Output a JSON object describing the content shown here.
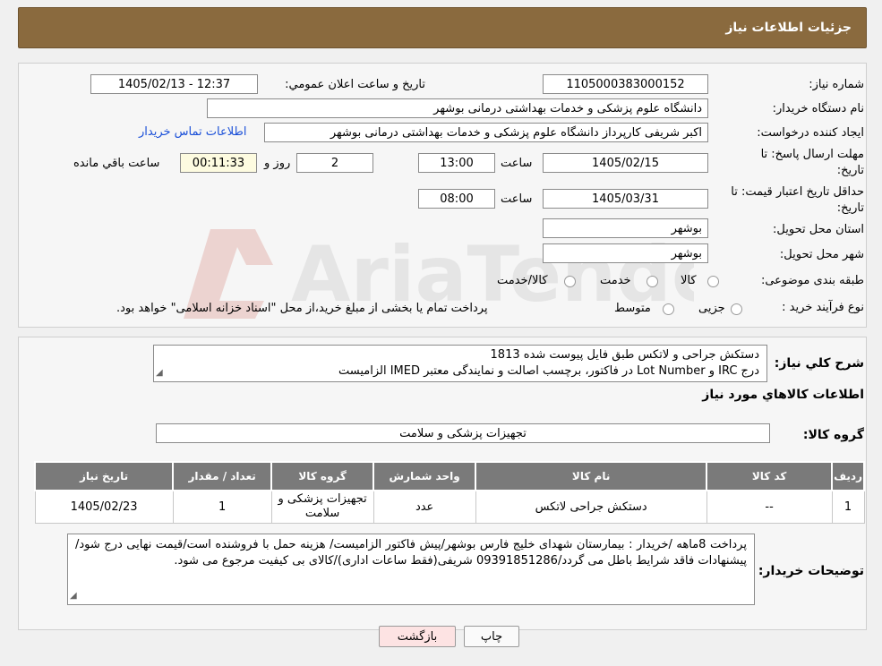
{
  "header": {
    "title": "جزئیات اطلاعات نیاز"
  },
  "form": {
    "need_number_label": "شماره نیاز:",
    "need_number": "1105000383000152",
    "announce_label": "تاریخ و ساعت اعلان عمومي:",
    "announce_value": "1405/02/13 - 12:37",
    "buyer_org_label": "نام دستگاه خریدار:",
    "buyer_org": "دانشگاه علوم پزشکی و خدمات بهداشتی درمانی بوشهر",
    "requester_label": "ایجاد کننده درخواست:",
    "requester": "اکبر شریفی کارپرداز دانشگاه علوم پزشکی و خدمات بهداشتی درمانی بوشهر",
    "contact_link": "اطلاعات تماس خریدار",
    "deadline_label": "مهلت ارسال پاسخ: تا تاریخ:",
    "deadline_date": "1405/02/15",
    "time_label": "ساعت",
    "deadline_time": "13:00",
    "days_value": "2",
    "days_label": "روز و",
    "remaining_time": "00:11:33",
    "remaining_label": "ساعت باقي مانده",
    "validity_label": "حداقل تاریخ اعتبار قیمت: تا تاریخ:",
    "validity_date": "1405/03/31",
    "validity_time": "08:00",
    "province_label": "استان محل تحویل:",
    "province": "بوشهر",
    "city_label": "شهر محل تحویل:",
    "city": "بوشهر",
    "category_label": "طبقه بندی موضوعی:",
    "category_options": [
      "کالا",
      "خدمت",
      "کالا/خدمت"
    ],
    "process_label": "نوع فرآیند خرید :",
    "process_options": [
      "جزیی",
      "متوسط"
    ],
    "process_note": "پرداخت تمام یا بخشی از مبلغ خرید،از محل \"اسناد خزانه اسلامی\" خواهد بود."
  },
  "description": {
    "label": "شرح کلي نیاز:",
    "line1": "دستکش جراحی و لاتکس طبق فایل پیوست شده 1813",
    "line2": "درج IRC و Lot Number در فاکتور، برچسب اصالت و نمایندگی معتبر IMED الزامیست"
  },
  "goods": {
    "section_title": "اطلاعات کالاهاي مورد نیاز",
    "group_label": "گروه کالا:",
    "group_value": "تجهیزات پزشکی و سلامت",
    "columns": [
      "ردیف",
      "کد کالا",
      "نام کالا",
      "واحد شمارش",
      "گروه کالا",
      "تعداد / مقدار",
      "تاریخ نیاز"
    ],
    "rows": [
      {
        "row": "1",
        "code": "--",
        "name": "دستکش جراحی لاتکس",
        "unit": "عدد",
        "group": "تجهیزات پزشکی و سلامت",
        "qty": "1",
        "date": "1405/02/23"
      }
    ]
  },
  "buyer_notes": {
    "label": "توضیحات خریدار:",
    "text": "پرداخت 8ماهه /خریدار : بیمارستان شهدای خلیج فارس بوشهر/پیش فاکتور الزامیست/ هزینه حمل با فروشنده است/قیمت نهایی درج شود/پیشنهادات فاقد شرایط باطل می گردد/09391851286 شریفی(فقط ساعات اداری)/کالای بی کیفیت مرجوع می شود."
  },
  "buttons": {
    "print": "چاپ",
    "back": "بازگشت"
  },
  "colors": {
    "header": "#8a6a3e",
    "back_button": "#fde3e3",
    "link": "#1a4fd8"
  }
}
